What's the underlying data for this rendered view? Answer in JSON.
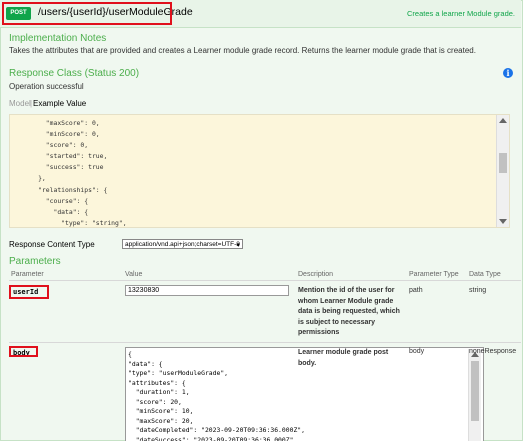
{
  "operation": {
    "method": "POST",
    "path": "/users/{userId}/userModuleGrade",
    "summary": "Creates a learner Module grade."
  },
  "implementation": {
    "heading": "Implementation Notes",
    "text": "Takes the attributes that are provided and creates a Learner module grade record. Returns the learner module grade that is created."
  },
  "response_class": {
    "heading": "Response Class (Status 200)",
    "status_text": "Operation successful",
    "tab_model": "Model",
    "tab_example": "Example Value",
    "example_value": "        \"maxScore\": 0,\n        \"minScore\": 0,\n        \"score\": 0,\n        \"started\": true,\n        \"success\": true\n      },\n      \"relationships\": {\n        \"course\": {\n          \"data\": {\n            \"type\": \"string\",\n            \"id\": \"string\""
  },
  "content_type": {
    "label": "Response Content Type",
    "value": "application/vnd.api+json;charset=UTF-8"
  },
  "parameters": {
    "heading": "Parameters",
    "columns": [
      "Parameter",
      "Value",
      "Description",
      "Parameter Type",
      "Data Type"
    ],
    "rows": [
      {
        "name": "userId",
        "value": "13230830",
        "description": "Mention the id of the user for whom Learner Module grade data is being requested, which is subject to necessary permissions",
        "param_type": "path",
        "data_type": "string"
      },
      {
        "name": "body",
        "value": "{\n\"data\": {\n\"type\": \"userModuleGrade\",\n\"attributes\": {\n  \"duration\": 1,\n  \"score\": 20,\n  \"minScore\": 10,\n  \"maxScore\": 20,\n  \"dateCompleted\": \"2023-09-20T09:36:36.000Z\",\n  \"dateSuccess\": \"2023-09-20T09:36:36.000Z\",\n  \"dateStarted\": \"2023-09-19T09:35:57.000Z\",",
        "description": "Learner module grade post body.",
        "param_type": "body",
        "data_type": "noneResponse"
      }
    ]
  },
  "colors": {
    "method_badge": "#10a54a",
    "heading_green": "#4cae4c",
    "highlight_red": "#e0101c",
    "info_blue": "#1a73e8",
    "code_background": "#fcf6db"
  }
}
